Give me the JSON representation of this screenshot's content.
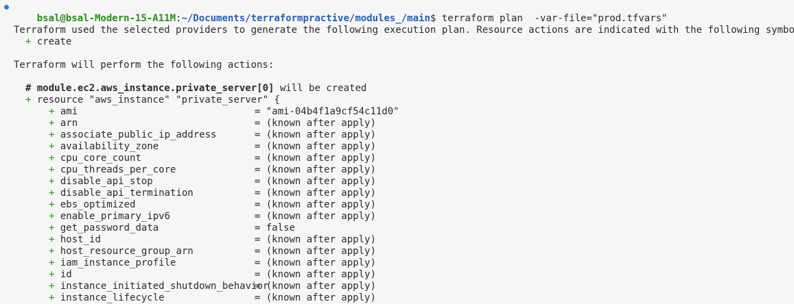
{
  "prompt": {
    "user_host": "bsal@bsal-Modern-15-A11M",
    "separator": ":",
    "path": "~/Documents/terraformpractive/modules_/main",
    "dollar": "$",
    "command": " terraform plan  -var-file=\"prod.tfvars\""
  },
  "intro": {
    "line1": "Terraform used the selected providers to generate the following execution plan. Resource actions are indicated with the following symbo",
    "create_symbol": "+",
    "create_label": "create",
    "line3": "Terraform will perform the following actions:"
  },
  "resource": {
    "comment_hash": "#",
    "address": "module.ec2.aws_instance.private_server[0]",
    "status": " will be created",
    "plus": "+",
    "declaration": "resource \"aws_instance\" \"private_server\" {"
  },
  "attributes": [
    {
      "name": "ami",
      "value": "\"ami-04b4f1a9cf54c11d0\""
    },
    {
      "name": "arn",
      "value": "(known after apply)"
    },
    {
      "name": "associate_public_ip_address",
      "value": "(known after apply)"
    },
    {
      "name": "availability_zone",
      "value": "(known after apply)"
    },
    {
      "name": "cpu_core_count",
      "value": "(known after apply)"
    },
    {
      "name": "cpu_threads_per_core",
      "value": "(known after apply)"
    },
    {
      "name": "disable_api_stop",
      "value": "(known after apply)"
    },
    {
      "name": "disable_api_termination",
      "value": "(known after apply)"
    },
    {
      "name": "ebs_optimized",
      "value": "(known after apply)"
    },
    {
      "name": "enable_primary_ipv6",
      "value": "(known after apply)"
    },
    {
      "name": "get_password_data",
      "value": "false"
    },
    {
      "name": "host_id",
      "value": "(known after apply)"
    },
    {
      "name": "host_resource_group_arn",
      "value": "(known after apply)"
    },
    {
      "name": "iam_instance_profile",
      "value": "(known after apply)"
    },
    {
      "name": "id",
      "value": "(known after apply)"
    },
    {
      "name": "instance_initiated_shutdown_behavior",
      "value": "(known after apply)"
    },
    {
      "name": "instance_lifecycle",
      "value": "(known after apply)"
    }
  ],
  "symbols": {
    "plus": "+",
    "equals": "= "
  },
  "colors": {
    "background": "#f6f6f6",
    "green": "#2e8b1f",
    "path_blue": "#2a5db0",
    "marker_blue": "#3a7bd5"
  }
}
